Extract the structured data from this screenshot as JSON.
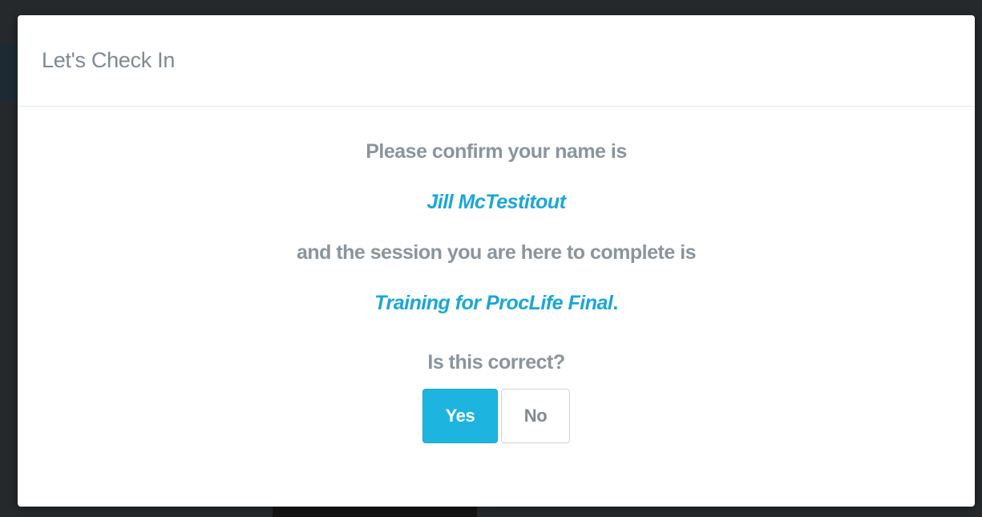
{
  "modal": {
    "title": "Let's Check In",
    "line_intro": "Please confirm your name is",
    "user_name": "Jill McTestitout",
    "line_session": "and the session you are here to complete is",
    "session_name": "Training for ProcLife Final",
    "session_suffix": ".",
    "question": "Is this correct?",
    "yes_label": "Yes",
    "no_label": "No"
  },
  "colors": {
    "accent": "#1db5e0",
    "text_muted": "#8a959c",
    "backdrop": "#25292c"
  }
}
